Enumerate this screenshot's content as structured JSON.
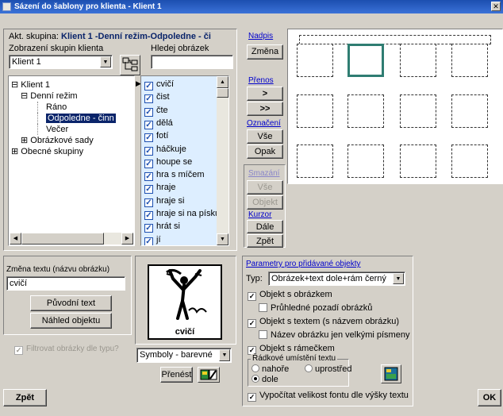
{
  "window": {
    "title": "Sázení do šablony pro klienta - Klient 1"
  },
  "group": {
    "label": "Akt. skupina:",
    "value": "Klient 1 -Denní režim-Odpoledne - či"
  },
  "client_group": {
    "label": "Zobrazení skupin klienta",
    "selected": "Klient 1"
  },
  "search": {
    "label": "Hledej obrázek",
    "value": ""
  },
  "tree": {
    "items": [
      "Klient 1",
      "Denní režim",
      "Ráno",
      "Odpoledne - činn",
      "Večer",
      "Obrázkové sady",
      "Obecné skupiny"
    ],
    "expand_minus": "⊟",
    "expand_plus": "⊞"
  },
  "word_list": {
    "items": [
      "cvičí",
      "čist",
      "čte",
      "dělá",
      "fotí",
      "háčkuje",
      "houpe se",
      "hra s míčem",
      "hraje",
      "hraje si",
      "hraje si na písku",
      "hrát si",
      "jí"
    ]
  },
  "title_section": {
    "link": "Nadpis",
    "change_button": "Změna"
  },
  "transfer": {
    "link": "Přenos",
    "one_button": ">",
    "all_button": ">>"
  },
  "marking": {
    "link": "Označení",
    "all_button": "Vše",
    "invert_button": "Opak"
  },
  "deletion": {
    "link": "Smazání",
    "all_button": "Vše",
    "object_button": "Objekt"
  },
  "cursor": {
    "link": "Kurzor",
    "next_button": "Dále",
    "back_button": "Zpět"
  },
  "text_change": {
    "label": "Změna textu (názvu obrázku)",
    "value": "cvičí",
    "original_button": "Původní text",
    "preview_button": "Náhled objektu"
  },
  "filter": {
    "label": "Filtrovat obrázky dle typu?"
  },
  "preview": {
    "caption": "cvičí",
    "symbol_set": "Symboly - barevné",
    "transfer_button": "Přenést"
  },
  "params": {
    "link": "Parametry pro přidávané objekty",
    "type_label": "Typ:",
    "type_value": "Obrázek+text dole+rám černý",
    "with_image": "Objekt s obrázkem",
    "transparent_bg": "Průhledné pozadí obrázků",
    "with_text": "Objekt s textem (s názvem obrázku)",
    "uppercase_name": "Název obrázku jen velkými písmeny",
    "with_frame": "Objekt s rámečkem",
    "text_position": {
      "title": "Řádkové umístění textu",
      "top": "nahoře",
      "middle": "uprostřed",
      "bottom": "dole"
    },
    "font_size": "Vypočítat velikost fontu dle výšky textu"
  },
  "footer": {
    "back_button": "Zpět",
    "ok_button": "OK"
  },
  "colors": {
    "titlebar": "#1c4fb0",
    "selection": "#0a246a",
    "active_tile": "#2f7d72",
    "link": "#0000cc",
    "list_bg": "#ddeeff"
  }
}
